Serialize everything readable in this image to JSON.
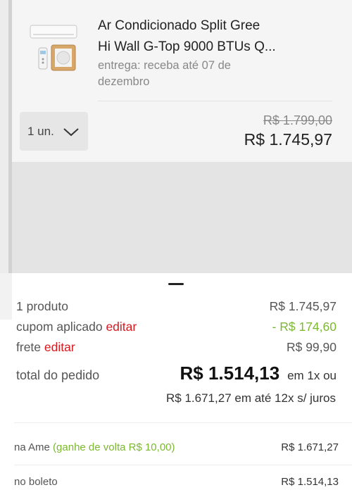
{
  "product": {
    "title_line1": "Ar Condicionado Split Gree",
    "title_line2": "Hi Wall G-Top 9000 BTUs Q...",
    "delivery_line1": "entrega: receba até 07 de",
    "delivery_line2": "dezembro",
    "quantity": "1 un.",
    "old_price": "R$ 1.799,00",
    "price": "R$ 1.745,97"
  },
  "summary": {
    "products_label": "1 produto",
    "products_value": "R$ 1.745,97",
    "coupon_label": "cupom aplicado",
    "coupon_edit": "editar",
    "coupon_value": "- R$ 174,60",
    "shipping_label": "frete",
    "shipping_edit": "editar",
    "shipping_value": "R$ 99,90",
    "total_label": "total do pedido",
    "total_value": "R$ 1.514,13",
    "total_suffix": "em 1x ou",
    "installments": "R$ 1.671,27 em até 12x s/ juros"
  },
  "payment_options": [
    {
      "label": "na Ame",
      "highlight": "(ganhe de volta R$ 10,00)",
      "value": "R$ 1.671,27"
    },
    {
      "label": "no boleto",
      "highlight": "",
      "value": "R$ 1.514,13"
    }
  ],
  "colors": {
    "accent_red": "#d71920",
    "accent_green": "#7cb82f"
  },
  "icons": {
    "quantity_dropdown": "chevron-down-icon",
    "product_image": "air-conditioner-icon"
  }
}
